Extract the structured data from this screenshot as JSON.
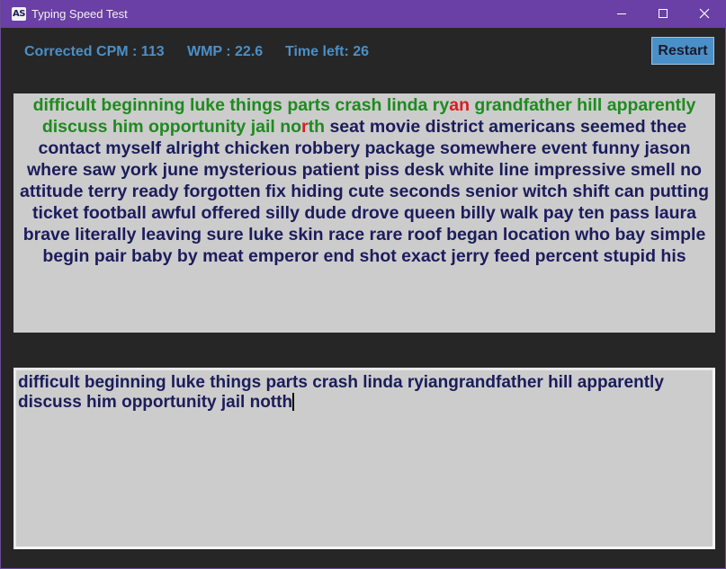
{
  "window": {
    "icon_text": "AS",
    "title": "Typing Speed Test"
  },
  "stats": {
    "cpm": "Corrected CPM : 113",
    "wpm": "WMP : 22.6",
    "time_left": "Time left: 26"
  },
  "restart_label": "Restart",
  "colors": {
    "title_bar": "#6a3fa6",
    "stat_text": "#4a90c8",
    "correct": "#1f8a1f",
    "wrong": "#d42020",
    "pending": "#1c1c5c",
    "panel_bg": "#cccccc"
  },
  "target_segments": [
    {
      "text": "difficult beginning luke things parts crash linda ry",
      "status": "correct"
    },
    {
      "text": "an",
      "status": "wrong"
    },
    {
      "text": " grandfather hill apparently discuss him opportunity jail no",
      "status": "correct"
    },
    {
      "text": "r",
      "status": "wrong"
    },
    {
      "text": "th",
      "status": "correct"
    },
    {
      "text": " seat movie district americans seemed thee contact myself alright chicken robbery package somewhere event funny jason where saw york june mysterious patient piss desk white line impressive smell no attitude terry ready forgotten fix hiding cute seconds senior witch shift can putting ticket football awful offered silly dude drove queen billy walk pay ten pass laura brave literally leaving sure luke skin race rare roof began location who bay simple begin pair baby by meat emperor end shot exact jerry feed percent stupid his",
      "status": "pending"
    }
  ],
  "typed_text": "difficult beginning luke things parts crash linda ryiangrandfather hill apparently discuss him opportunity jail notth"
}
